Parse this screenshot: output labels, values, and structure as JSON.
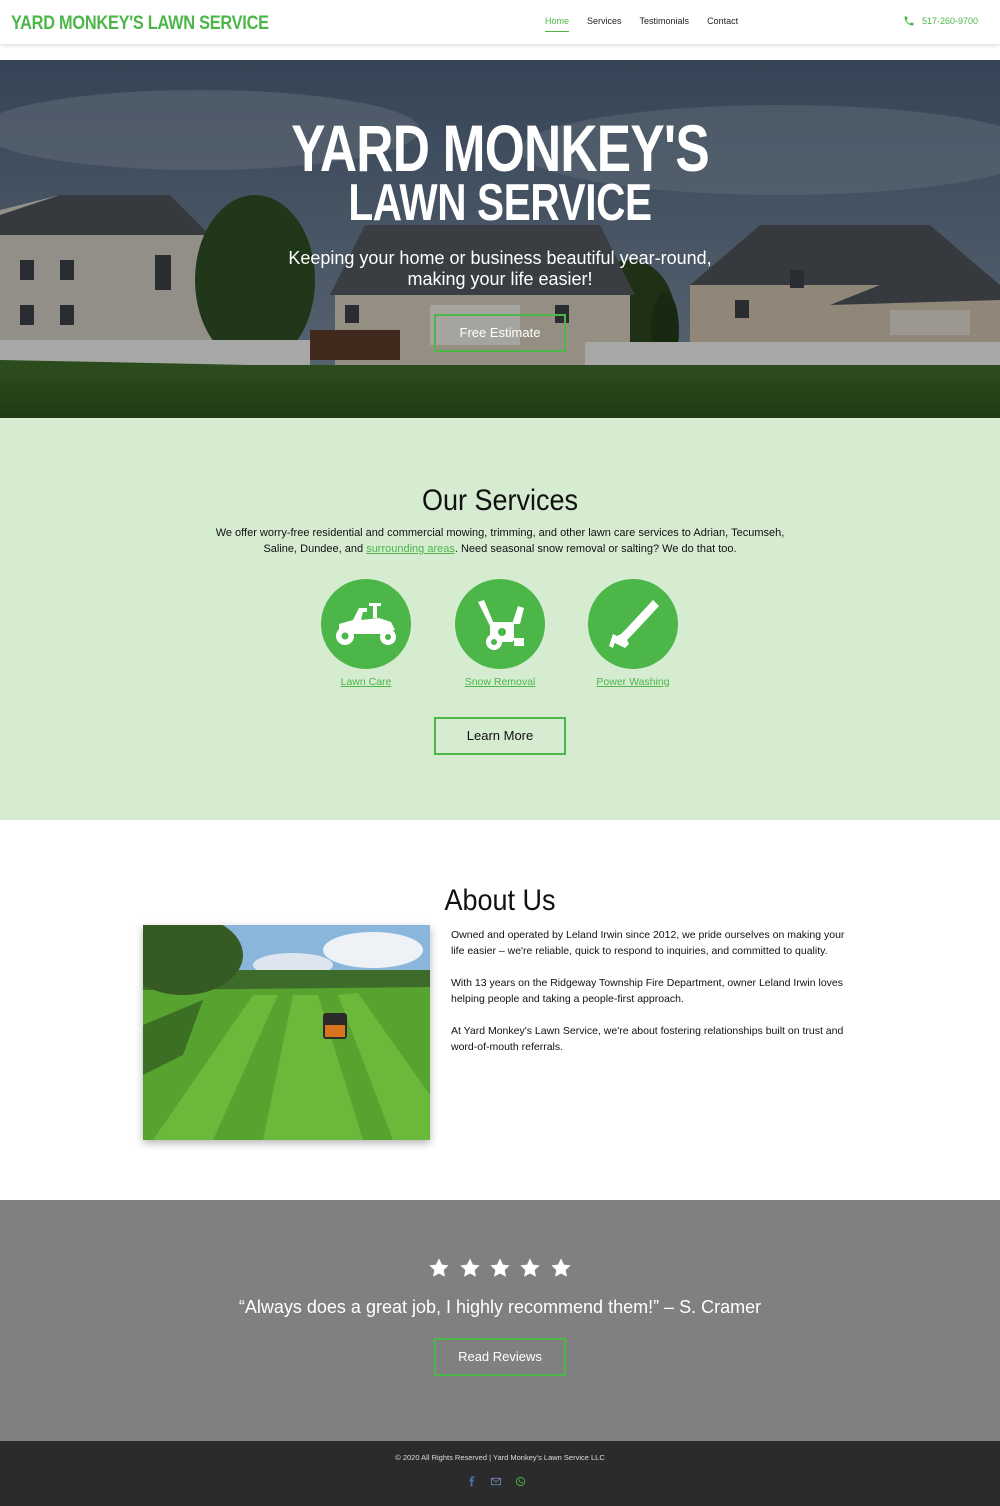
{
  "header": {
    "logo": "YARD MONKEY'S LAWN SERVICE",
    "nav": [
      {
        "label": "Home",
        "active": true
      },
      {
        "label": "Services",
        "active": false
      },
      {
        "label": "Testimonials",
        "active": false
      },
      {
        "label": "Contact",
        "active": false
      }
    ],
    "phone": "517-260-9700",
    "phone_icon": "phone-icon"
  },
  "hero": {
    "title_line1": "YARD MONKEY'S",
    "title_line2": "LAWN SERVICE",
    "tagline_line1": "Keeping your home or business beautiful year-round,",
    "tagline_line2": "making your life easier!",
    "cta": "Free Estimate"
  },
  "services": {
    "title": "Our Services",
    "desc_part1": "We offer worry-free residential and commercial mowing, trimming, and other lawn care services to Adrian, Tecumseh, Saline, Dundee, and ",
    "desc_link": "surrounding areas",
    "desc_part2": ". Need seasonal snow removal or salting? We do that too.",
    "items": [
      {
        "label": "Lawn Care",
        "icon": "riding-mower-icon"
      },
      {
        "label": "Snow Removal",
        "icon": "snowblower-icon"
      },
      {
        "label": "Power Washing",
        "icon": "pressure-washer-icon"
      }
    ],
    "cta": "Learn More"
  },
  "about": {
    "title": "About Us",
    "paragraphs": [
      "Owned and operated by Leland Irwin since 2012, we pride ourselves on making your life easier – we're reliable, quick to respond to inquiries, and committed to quality.",
      "With 13 years on the Ridgeway Township Fire Department, owner Leland Irwin loves helping people and taking a people-first approach.",
      "At Yard Monkey's Lawn Service, we're about fostering relationships built on trust and word-of-mouth referrals."
    ]
  },
  "testimonial": {
    "rating": 5,
    "quote": "“Always does a great job, I highly recommend them!” – S. Cramer",
    "cta": "Read Reviews"
  },
  "footer": {
    "copyright": "© 2020 All Rights Reserved | Yard Monkey's Lawn Service LLC",
    "social": [
      "facebook-icon",
      "email-icon",
      "whatsapp-icon"
    ]
  },
  "colors": {
    "brand_green": "#4cb648",
    "services_bg": "#d5ecd1",
    "testimonial_bg": "#808080",
    "footer_bg": "#2b2b2b"
  }
}
